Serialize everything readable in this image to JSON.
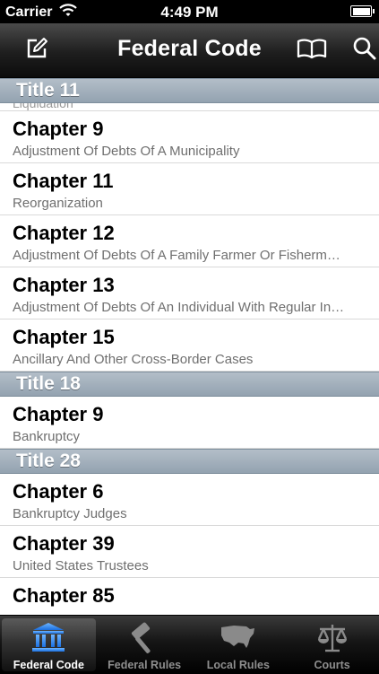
{
  "status_bar": {
    "carrier": "Carrier",
    "time": "4:49 PM"
  },
  "nav": {
    "title": "Federal Code",
    "left_icon": "compose-icon",
    "right_icons": [
      "book-icon",
      "search-icon"
    ]
  },
  "list": {
    "partial_top_text": "Liquidation",
    "sections": [
      {
        "header": "Title 11",
        "rows": [
          {
            "title": "Chapter 9",
            "subtitle": "Adjustment Of Debts Of A Municipality"
          },
          {
            "title": "Chapter 11",
            "subtitle": "Reorganization"
          },
          {
            "title": "Chapter 12",
            "subtitle": "Adjustment Of Debts Of A Family Farmer Or Fisherm…"
          },
          {
            "title": "Chapter 13",
            "subtitle": "Adjustment Of Debts Of An Individual With Regular In…"
          },
          {
            "title": "Chapter 15",
            "subtitle": "Ancillary And Other Cross-Border Cases"
          }
        ]
      },
      {
        "header": "Title 18",
        "rows": [
          {
            "title": "Chapter 9",
            "subtitle": "Bankruptcy"
          }
        ]
      },
      {
        "header": "Title 28",
        "rows": [
          {
            "title": "Chapter 6",
            "subtitle": "Bankruptcy Judges"
          },
          {
            "title": "Chapter 39",
            "subtitle": "United States Trustees"
          },
          {
            "title": "Chapter 85",
            "subtitle": ""
          }
        ]
      }
    ]
  },
  "tab_bar": {
    "selected": "Federal Code",
    "tabs": [
      {
        "label": "Federal Code",
        "icon": "courthouse-icon"
      },
      {
        "label": "Federal Rules",
        "icon": "gavel-icon"
      },
      {
        "label": "Local Rules",
        "icon": "us-map-icon"
      },
      {
        "label": "Courts",
        "icon": "scales-icon"
      }
    ]
  },
  "colors": {
    "section_header": "#a3b1be",
    "subtitle_text": "#6f6f6f",
    "tab_inactive": "#8e8e8e"
  }
}
